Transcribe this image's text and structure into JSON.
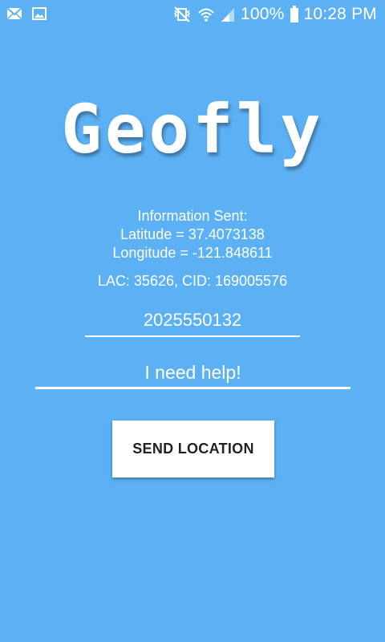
{
  "status_bar": {
    "battery_percent": "100%",
    "time": "10:28 PM",
    "icons": [
      "mail-icon",
      "image-icon",
      "vibrate-mute-icon",
      "wifi-icon",
      "signal-icon",
      "battery-icon"
    ]
  },
  "app": {
    "logo_text": "Geofly"
  },
  "info": {
    "header": "Information Sent:",
    "latitude": "Latitude = 37.4073138",
    "longitude": "Longitude = -121.848611",
    "cell": "LAC: 35626, CID: 169005576"
  },
  "form": {
    "phone_value": "2025550132",
    "message_value": "I need help!",
    "send_label": "SEND LOCATION"
  },
  "colors": {
    "background": "#5cb1f5",
    "text": "#ffffff",
    "button_bg": "#ffffff",
    "button_text": "#222222"
  }
}
